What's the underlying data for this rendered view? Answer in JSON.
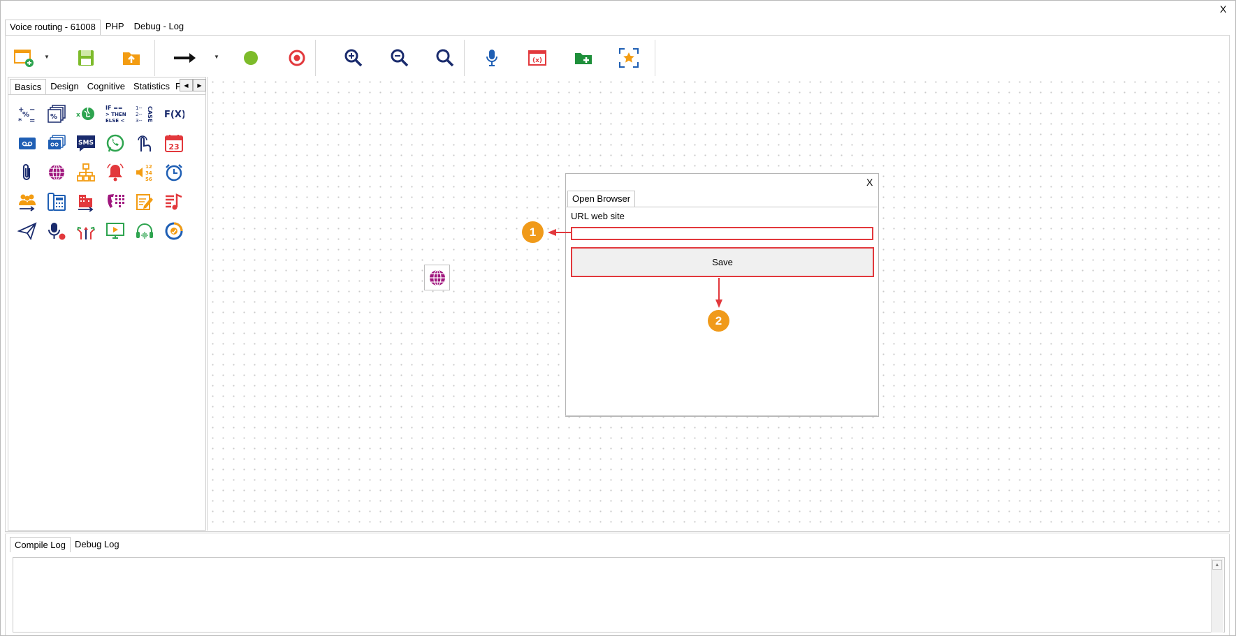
{
  "window": {
    "close_label": "X"
  },
  "top_tabs": [
    {
      "label": "Voice routing - 61008",
      "active": true
    },
    {
      "label": "PHP",
      "active": false
    },
    {
      "label": "Debug - Log",
      "active": false
    }
  ],
  "toolbar": {
    "buttons": [
      {
        "name": "new-window-button",
        "icon": "window-add-icon",
        "has_dropdown": true
      },
      {
        "name": "save-button",
        "icon": "floppy-disk-icon"
      },
      {
        "name": "open-folder-button",
        "icon": "folder-upload-icon"
      },
      {
        "name": "run-arrow-button",
        "icon": "arrow-right-icon",
        "has_dropdown": true
      },
      {
        "name": "start-button",
        "icon": "green-circle-icon"
      },
      {
        "name": "stop-button",
        "icon": "red-target-icon"
      },
      {
        "name": "zoom-in-button",
        "icon": "zoom-in-icon"
      },
      {
        "name": "zoom-out-button",
        "icon": "zoom-out-icon"
      },
      {
        "name": "zoom-fit-button",
        "icon": "zoom-icon"
      },
      {
        "name": "microphone-button",
        "icon": "microphone-icon"
      },
      {
        "name": "variables-button",
        "icon": "variable-window-icon"
      },
      {
        "name": "add-folder-button",
        "icon": "folder-add-icon"
      },
      {
        "name": "fit-screen-button",
        "icon": "fit-star-icon"
      }
    ],
    "colors": {
      "accent_orange": "#f39c12",
      "green": "#2ea44f",
      "red": "#e2383c",
      "navy": "#1a2b6d"
    }
  },
  "palette": {
    "tabs": [
      {
        "label": "Basics",
        "active": true
      },
      {
        "label": "Design",
        "active": false
      },
      {
        "label": "Cognitive",
        "active": false
      },
      {
        "label": "Statistics",
        "active": false
      },
      {
        "label": "Pe",
        "active": false
      }
    ],
    "icons": [
      "math-operators-icon",
      "percent-stack-icon",
      "globe-variable-icon",
      "if-then-else-icon",
      "case-icon",
      "function-fx-icon",
      "voicemail-card-icon",
      "card-stack-icon",
      "sms-icon",
      "whatsapp-icon",
      "touch-keypad-icon",
      "calendar-23-icon",
      "paperclip-icon",
      "globe-icon",
      "org-chart-icon",
      "alarm-bell-icon",
      "speaker-numbers-icon",
      "alarm-clock-icon",
      "team-transfer-icon",
      "desk-phone-icon",
      "building-transfer-icon",
      "phone-keypad-icon",
      "edit-note-icon",
      "music-list-icon",
      "paper-plane-icon",
      "mic-record-icon",
      "split-arrows-icon",
      "screen-play-icon",
      "headset-wave-icon",
      "refresh-badge-icon"
    ],
    "text": {
      "if_then_else": "IF == > THEN ELSE <",
      "fx": "F(X)",
      "sms": "SMS",
      "cal_day": "23",
      "case": "CASE",
      "num": "12 34 56"
    }
  },
  "canvas": {
    "node_icon": "globe-icon"
  },
  "dialog": {
    "close_label": "X",
    "tab_label": "Open Browser",
    "url_label": "URL web site",
    "url_value": "",
    "url_placeholder": "",
    "save_label": "Save",
    "markers": [
      "1",
      "2"
    ]
  },
  "logs": {
    "tabs": [
      {
        "label": "Compile Log",
        "active": true
      },
      {
        "label": "Debug Log",
        "active": false
      }
    ],
    "content": ""
  }
}
